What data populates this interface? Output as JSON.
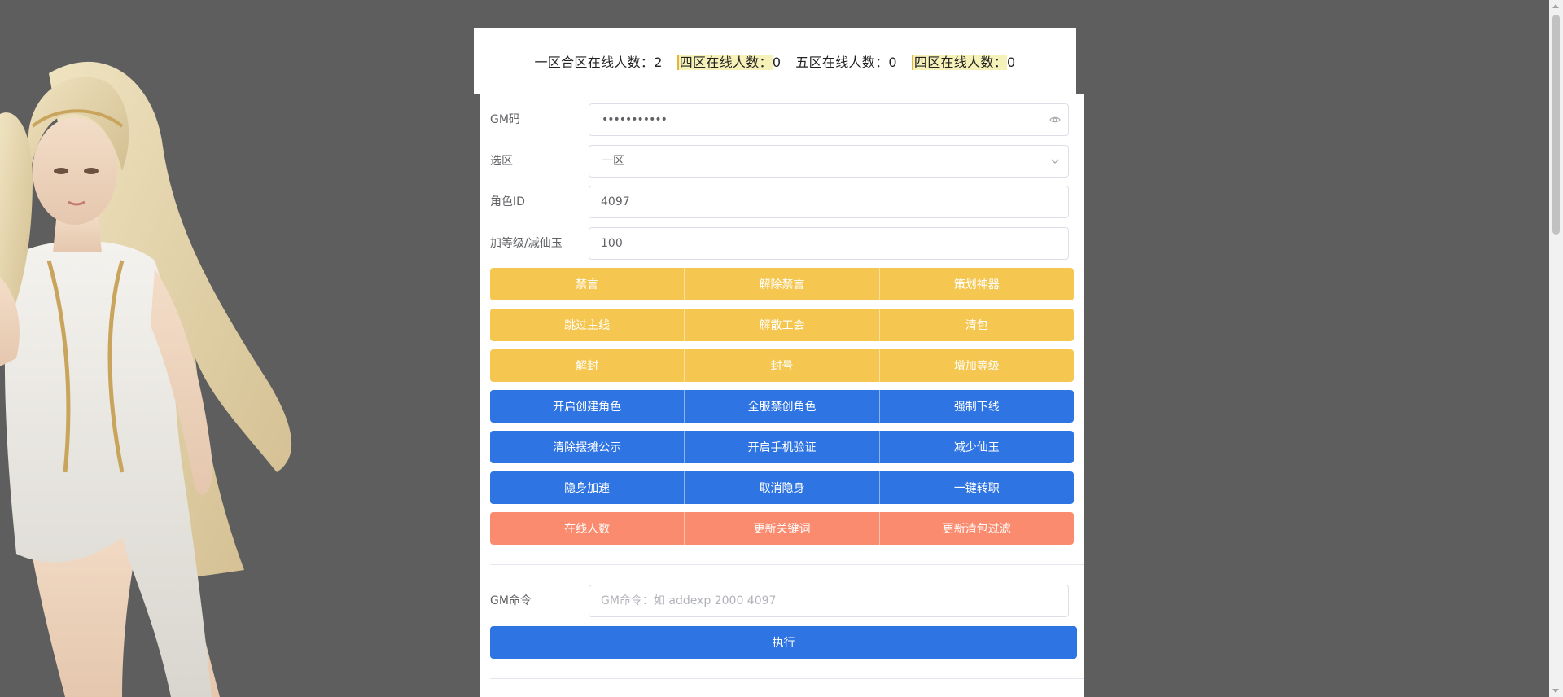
{
  "header": {
    "zones": [
      {
        "label": "一区合区在线人数：",
        "count": "2",
        "highlight": false
      },
      {
        "label": "四区在线人数：",
        "count": "0",
        "highlight": true
      },
      {
        "label": "五区在线人数：",
        "count": "0",
        "highlight": false
      },
      {
        "label": "四区在线人数：",
        "count": "0",
        "highlight": true
      }
    ]
  },
  "form": {
    "gm_code": {
      "label": "GM码",
      "value": "•••••••••••"
    },
    "zone_select": {
      "label": "选区",
      "value": "一区"
    },
    "role_id": {
      "label": "角色ID",
      "value": "4097"
    },
    "amount": {
      "label": "加等级/减仙玉",
      "value": "100"
    }
  },
  "button_rows": [
    {
      "color": "yellow",
      "buttons": [
        "禁言",
        "解除禁言",
        "策划神器"
      ]
    },
    {
      "color": "yellow",
      "buttons": [
        "跳过主线",
        "解散工会",
        "清包"
      ]
    },
    {
      "color": "yellow",
      "buttons": [
        "解封",
        "封号",
        "增加等级"
      ]
    },
    {
      "color": "blue",
      "buttons": [
        "开启创建角色",
        "全服禁创角色",
        "强制下线"
      ]
    },
    {
      "color": "blue",
      "buttons": [
        "清除摆摊公示",
        "开启手机验证",
        "减少仙玉"
      ]
    },
    {
      "color": "blue",
      "buttons": [
        "隐身加速",
        "取消隐身",
        "一键转职"
      ]
    },
    {
      "color": "salmon",
      "buttons": [
        "在线人数",
        "更新关键词",
        "更新清包过滤"
      ]
    }
  ],
  "command": {
    "label": "GM命令",
    "placeholder": "GM命令：如 addexp 2000 4097",
    "execute_label": "执行"
  },
  "colors": {
    "background": "#5e5e5e",
    "yellow": "#f5c751",
    "blue": "#2f74e3",
    "salmon": "#fb8b6e"
  },
  "icons": {
    "password_toggle": "eye-icon",
    "select_arrow": "chevron-down-icon"
  }
}
